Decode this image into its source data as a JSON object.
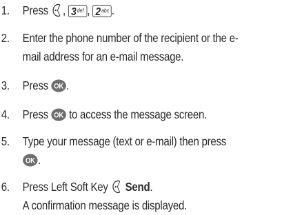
{
  "steps": [
    {
      "number": "1.",
      "press": "Press",
      "keys": [
        {
          "icon": "left-soft-key-icon"
        },
        {
          "icon": "key-3-icon",
          "digit": "3",
          "letters": "def"
        },
        {
          "icon": "key-2-icon",
          "digit": "2",
          "letters": "abc"
        }
      ],
      "sep": ",",
      "end": "."
    },
    {
      "number": "2.",
      "line1": "Enter the phone number of the recipient or the e-",
      "line2": "mail address for an e-mail message."
    },
    {
      "number": "3.",
      "press": "Press",
      "key": {
        "icon": "ok-key-icon",
        "label": "OK"
      },
      "end": "."
    },
    {
      "number": "4.",
      "press": "Press",
      "key": {
        "icon": "ok-key-icon",
        "label": "OK"
      },
      "rest": "to access the message screen."
    },
    {
      "number": "5.",
      "line1": "Type your message (text or e-mail) then press",
      "key": {
        "icon": "ok-key-icon",
        "label": "OK"
      },
      "end": "."
    },
    {
      "number": "6.",
      "line1_prefix": "Press Left Soft Key",
      "key": {
        "icon": "left-soft-key-icon"
      },
      "bold": "Send",
      "end": ".",
      "line2": "A confirmation message is displayed."
    }
  ]
}
